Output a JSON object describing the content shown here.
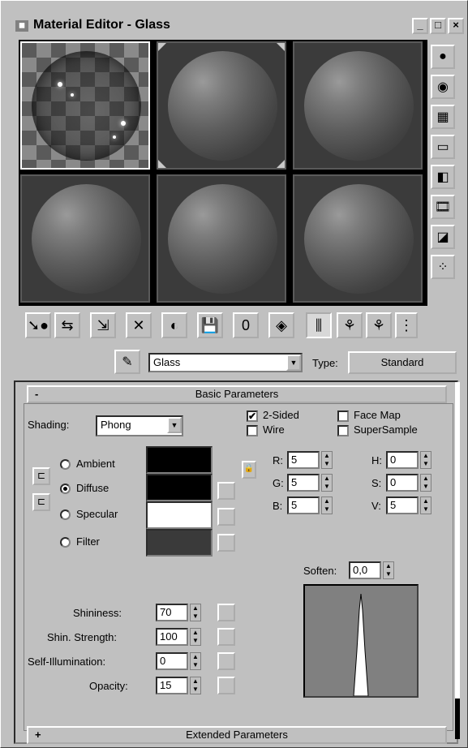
{
  "window": {
    "title": "Material Editor - Glass",
    "controls": {
      "minimize": "_",
      "maximize": "□",
      "close": "×"
    }
  },
  "slots": {
    "active_index": 0,
    "count": 6
  },
  "side_tools": [
    {
      "name": "sample-type-sphere-icon",
      "glyph": "●"
    },
    {
      "name": "backlight-icon",
      "glyph": "◉"
    },
    {
      "name": "background-checker-icon",
      "glyph": "▦"
    },
    {
      "name": "sample-uv-tiling-icon",
      "glyph": "▭"
    },
    {
      "name": "video-color-check-icon",
      "glyph": "◧"
    },
    {
      "name": "make-preview-icon",
      "glyph": "🎞"
    },
    {
      "name": "options-icon",
      "glyph": "◪"
    },
    {
      "name": "select-by-material-icon",
      "glyph": "⁘"
    }
  ],
  "bottom_tools": [
    {
      "name": "get-material-icon",
      "glyph": "➘●",
      "pressed": false
    },
    {
      "name": "put-to-scene-icon",
      "glyph": "⇆",
      "pressed": false
    },
    {
      "name": "assign-to-selection-icon",
      "glyph": "⇲",
      "pressed": false
    },
    {
      "name": "reset-map-icon",
      "glyph": "✕",
      "pressed": false
    },
    {
      "name": "make-copy-icon",
      "glyph": "◐",
      "pressed": false
    },
    {
      "name": "put-to-library-icon",
      "glyph": "💾",
      "pressed": false
    },
    {
      "name": "material-effects-channel-icon",
      "glyph": "0",
      "pressed": false
    },
    {
      "name": "show-map-in-viewport-icon",
      "glyph": "◈",
      "pressed": false
    },
    {
      "name": "show-end-result-icon",
      "glyph": "⫼",
      "pressed": true
    },
    {
      "name": "go-to-parent-icon",
      "glyph": "⚘",
      "pressed": false
    },
    {
      "name": "go-forward-to-sibling-icon",
      "glyph": "⚘",
      "pressed": false
    },
    {
      "name": "material-map-navigator-icon",
      "glyph": "⋮"
    }
  ],
  "name_row": {
    "material_name": "Glass",
    "type_label": "Type:",
    "type_value": "Standard"
  },
  "basic": {
    "rollout_sign": "-",
    "rollout_title": "Basic Parameters",
    "shading_label": "Shading:",
    "shading_value": "Phong",
    "two_sided_label": "2-Sided",
    "two_sided": true,
    "wire_label": "Wire",
    "wire": false,
    "face_map_label": "Face Map",
    "face_map": false,
    "supersample_label": "SuperSample",
    "supersample": false,
    "ambient_label": "Ambient",
    "diffuse_label": "Diffuse",
    "specular_label": "Specular",
    "filter_label": "Filter",
    "selected_color": "Diffuse",
    "colors": {
      "ambient": "#000000",
      "diffuse": "#000000",
      "specular": "#ffffff",
      "filter": "#3a3a3a"
    },
    "r_label": "R:",
    "r_value": "5",
    "g_label": "G:",
    "g_value": "5",
    "b_label": "B:",
    "b_value": "5",
    "h_label": "H:",
    "h_value": "0",
    "s_label": "S:",
    "s_value": "0",
    "v_label": "V:",
    "v_value": "5",
    "soften_label": "Soften:",
    "soften_value": "0,0",
    "shininess_label": "Shininess:",
    "shininess_value": "70",
    "shin_strength_label": "Shin. Strength:",
    "shin_strength_value": "100",
    "self_illum_label": "Self-Illumination:",
    "self_illum_value": "0",
    "opacity_label": "Opacity:",
    "opacity_value": "15"
  },
  "extended": {
    "rollout_sign": "+",
    "rollout_title": "Extended Parameters"
  }
}
